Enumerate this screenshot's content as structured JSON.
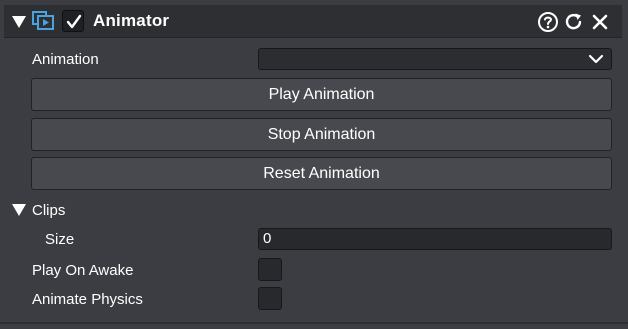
{
  "header": {
    "title": "Animator",
    "enabled": true,
    "icon": "animator-component-icon",
    "help_icon": "help-icon",
    "reset_icon": "reset-icon",
    "close_icon": "close-icon"
  },
  "fields": {
    "animation_label": "Animation",
    "animation_value": "",
    "play_label": "Play Animation",
    "stop_label": "Stop Animation",
    "reset_label": "Reset Animation",
    "clips_label": "Clips",
    "size_label": "Size",
    "size_value": "0",
    "play_on_awake_label": "Play On Awake",
    "play_on_awake_checked": false,
    "animate_physics_label": "Animate Physics",
    "animate_physics_checked": false
  },
  "colors": {
    "panel_bg": "#3b3d42",
    "header_bg": "#2d2f33",
    "button_bg": "#47494e",
    "field_bg": "#27292d",
    "icon_accent": "#4aa3df"
  }
}
